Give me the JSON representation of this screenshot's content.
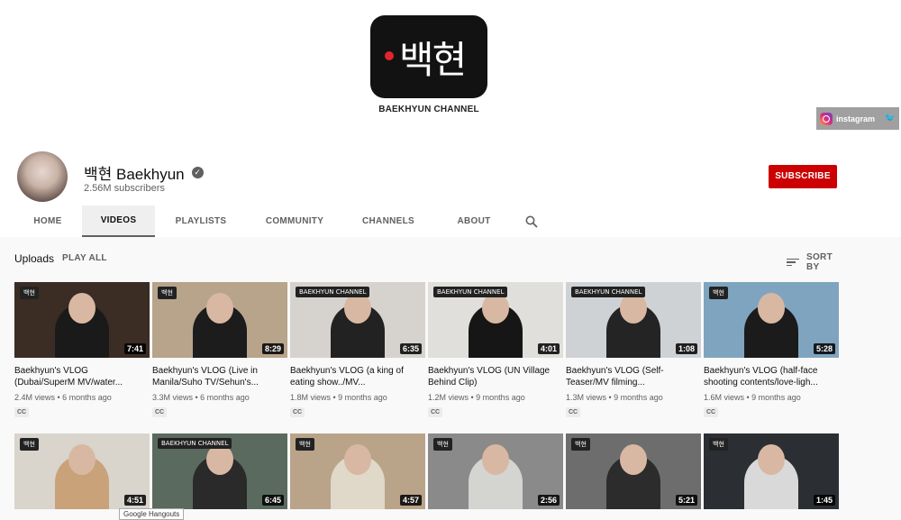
{
  "banner": {
    "logo_text": "백현",
    "logo_caption": "BAEKHYUN CHANNEL",
    "social_label": "instagram",
    "accent": "#e4242b"
  },
  "channel": {
    "name": "백현 Baekhyun",
    "subscribers": "2.56M subscribers",
    "subscribe_label": "SUBSCRIBE",
    "subscribe_color": "#cc0000"
  },
  "tabs": [
    {
      "label": "HOME",
      "active": false
    },
    {
      "label": "VIDEOS",
      "active": true
    },
    {
      "label": "PLAYLISTS",
      "active": false
    },
    {
      "label": "COMMUNITY",
      "active": false
    },
    {
      "label": "CHANNELS",
      "active": false
    },
    {
      "label": "ABOUT",
      "active": false
    }
  ],
  "uploads": {
    "label": "Uploads",
    "play_all": "PLAY ALL",
    "sort_label": "SORT BY"
  },
  "videos": [
    {
      "title": "Baekhyun's VLOG (Dubai/SuperM MV/water...",
      "views": "2.4M views",
      "age": "6 months ago",
      "duration": "7:41",
      "cc": "CC",
      "badge": "백현",
      "bg": "#3b2c24",
      "shirt": "#1a1a1a"
    },
    {
      "title": "Baekhyun's VLOG (Live in Manila/Suho TV/Sehun's...",
      "views": "3.3M views",
      "age": "6 months ago",
      "duration": "8:29",
      "cc": "CC",
      "badge": "백현",
      "bg": "#b7a48b",
      "shirt": "#1c1c1c"
    },
    {
      "title": "Baekhyun's VLOG (a king of eating show../MV...",
      "views": "1.8M views",
      "age": "9 months ago",
      "duration": "6:35",
      "cc": "CC",
      "badge": "BAEKHYUN CHANNEL",
      "bg": "#d6d3cf",
      "shirt": "#222"
    },
    {
      "title": "Baekhyun's VLOG (UN Village Behind Clip)",
      "views": "1.2M views",
      "age": "9 months ago",
      "duration": "4:01",
      "cc": "CC",
      "badge": "BAEKHYUN CHANNEL",
      "bg": "#e1dfdc",
      "shirt": "#161616"
    },
    {
      "title": "Baekhyun's VLOG (Self-Teaser/MV filming...",
      "views": "1.3M views",
      "age": "9 months ago",
      "duration": "1:08",
      "cc": "CC",
      "badge": "BAEKHYUN CHANNEL",
      "bg": "#cfd2d4",
      "shirt": "#242424"
    },
    {
      "title": "Baekhyun's VLOG (half-face shooting contents/love-ligh...",
      "views": "1.6M views",
      "age": "9 months ago",
      "duration": "5:28",
      "cc": "CC",
      "badge": "백현",
      "bg": "#7fa4bf",
      "shirt": "#1b1b1b"
    },
    {
      "duration": "4:51",
      "badge": "백현",
      "bg": "#d9d4cc",
      "shirt": "#c9a27a"
    },
    {
      "duration": "6:45",
      "badge": "BAEKHYUN CHANNEL",
      "bg": "#5a6a5e",
      "shirt": "#2a2a2a"
    },
    {
      "duration": "4:57",
      "badge": "백현",
      "bg": "#b9a48a",
      "shirt": "#e0d8c8"
    },
    {
      "duration": "2:56",
      "badge": "백현",
      "bg": "#8a8a8a",
      "shirt": "#d4d4d0"
    },
    {
      "duration": "5:21",
      "badge": "백현",
      "bg": "#6d6d6d",
      "shirt": "#2c2c2c"
    },
    {
      "duration": "1:45",
      "badge": "백현",
      "bg": "#2b2e33",
      "shirt": "#d9d9d9"
    }
  ],
  "tooltip": "Google Hangouts"
}
